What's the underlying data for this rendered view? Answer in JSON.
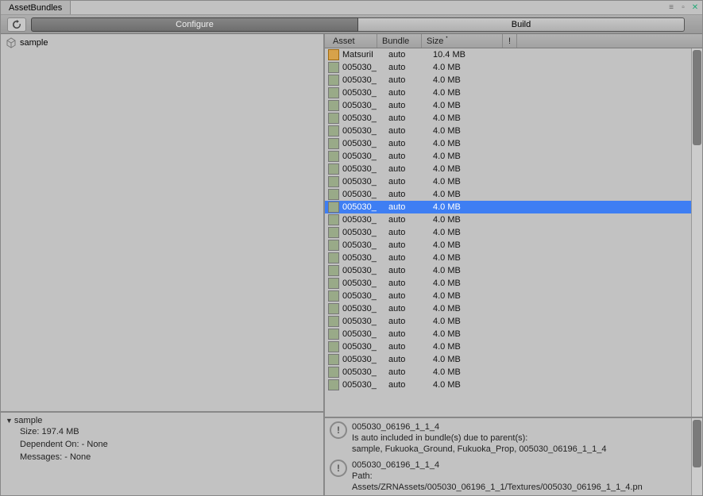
{
  "window": {
    "title": "AssetBundles"
  },
  "toolbar": {
    "configure_label": "Configure",
    "build_label": "Build",
    "active_segment": 0
  },
  "tree": {
    "items": [
      {
        "label": "sample"
      }
    ]
  },
  "details": {
    "name": "sample",
    "size_label": "Size: 197.4 MB",
    "dependent_label": "Dependent On: - None",
    "messages_label": "Messages: - None"
  },
  "columns": {
    "asset": "Asset",
    "bundle": "Bundle",
    "size": "Size",
    "warn": "!"
  },
  "rows": [
    {
      "asset": "MatsuriI",
      "bundle": "auto",
      "size": "10.4 MB",
      "prefab": true
    },
    {
      "asset": "005030_",
      "bundle": "auto",
      "size": "4.0 MB"
    },
    {
      "asset": "005030_",
      "bundle": "auto",
      "size": "4.0 MB"
    },
    {
      "asset": "005030_",
      "bundle": "auto",
      "size": "4.0 MB"
    },
    {
      "asset": "005030_",
      "bundle": "auto",
      "size": "4.0 MB"
    },
    {
      "asset": "005030_",
      "bundle": "auto",
      "size": "4.0 MB"
    },
    {
      "asset": "005030_",
      "bundle": "auto",
      "size": "4.0 MB"
    },
    {
      "asset": "005030_",
      "bundle": "auto",
      "size": "4.0 MB"
    },
    {
      "asset": "005030_",
      "bundle": "auto",
      "size": "4.0 MB"
    },
    {
      "asset": "005030_",
      "bundle": "auto",
      "size": "4.0 MB"
    },
    {
      "asset": "005030_",
      "bundle": "auto",
      "size": "4.0 MB"
    },
    {
      "asset": "005030_",
      "bundle": "auto",
      "size": "4.0 MB"
    },
    {
      "asset": "005030_",
      "bundle": "auto",
      "size": "4.0 MB",
      "selected": true
    },
    {
      "asset": "005030_",
      "bundle": "auto",
      "size": "4.0 MB"
    },
    {
      "asset": "005030_",
      "bundle": "auto",
      "size": "4.0 MB"
    },
    {
      "asset": "005030_",
      "bundle": "auto",
      "size": "4.0 MB"
    },
    {
      "asset": "005030_",
      "bundle": "auto",
      "size": "4.0 MB"
    },
    {
      "asset": "005030_",
      "bundle": "auto",
      "size": "4.0 MB"
    },
    {
      "asset": "005030_",
      "bundle": "auto",
      "size": "4.0 MB"
    },
    {
      "asset": "005030_",
      "bundle": "auto",
      "size": "4.0 MB"
    },
    {
      "asset": "005030_",
      "bundle": "auto",
      "size": "4.0 MB"
    },
    {
      "asset": "005030_",
      "bundle": "auto",
      "size": "4.0 MB"
    },
    {
      "asset": "005030_",
      "bundle": "auto",
      "size": "4.0 MB"
    },
    {
      "asset": "005030_",
      "bundle": "auto",
      "size": "4.0 MB"
    },
    {
      "asset": "005030_",
      "bundle": "auto",
      "size": "4.0 MB"
    },
    {
      "asset": "005030_",
      "bundle": "auto",
      "size": "4.0 MB"
    },
    {
      "asset": "005030_",
      "bundle": "auto",
      "size": "4.0 MB"
    }
  ],
  "messages": [
    {
      "line1": "005030_06196_1_1_4",
      "line2": "Is auto included in bundle(s) due to parent(s):",
      "line3": "sample, Fukuoka_Ground, Fukuoka_Prop, 005030_06196_1_1_4"
    },
    {
      "line1": "005030_06196_1_1_4",
      "line2": "Path:",
      "line3": "Assets/ZRNAssets/005030_06196_1_1/Textures/005030_06196_1_1_4.pn"
    }
  ]
}
